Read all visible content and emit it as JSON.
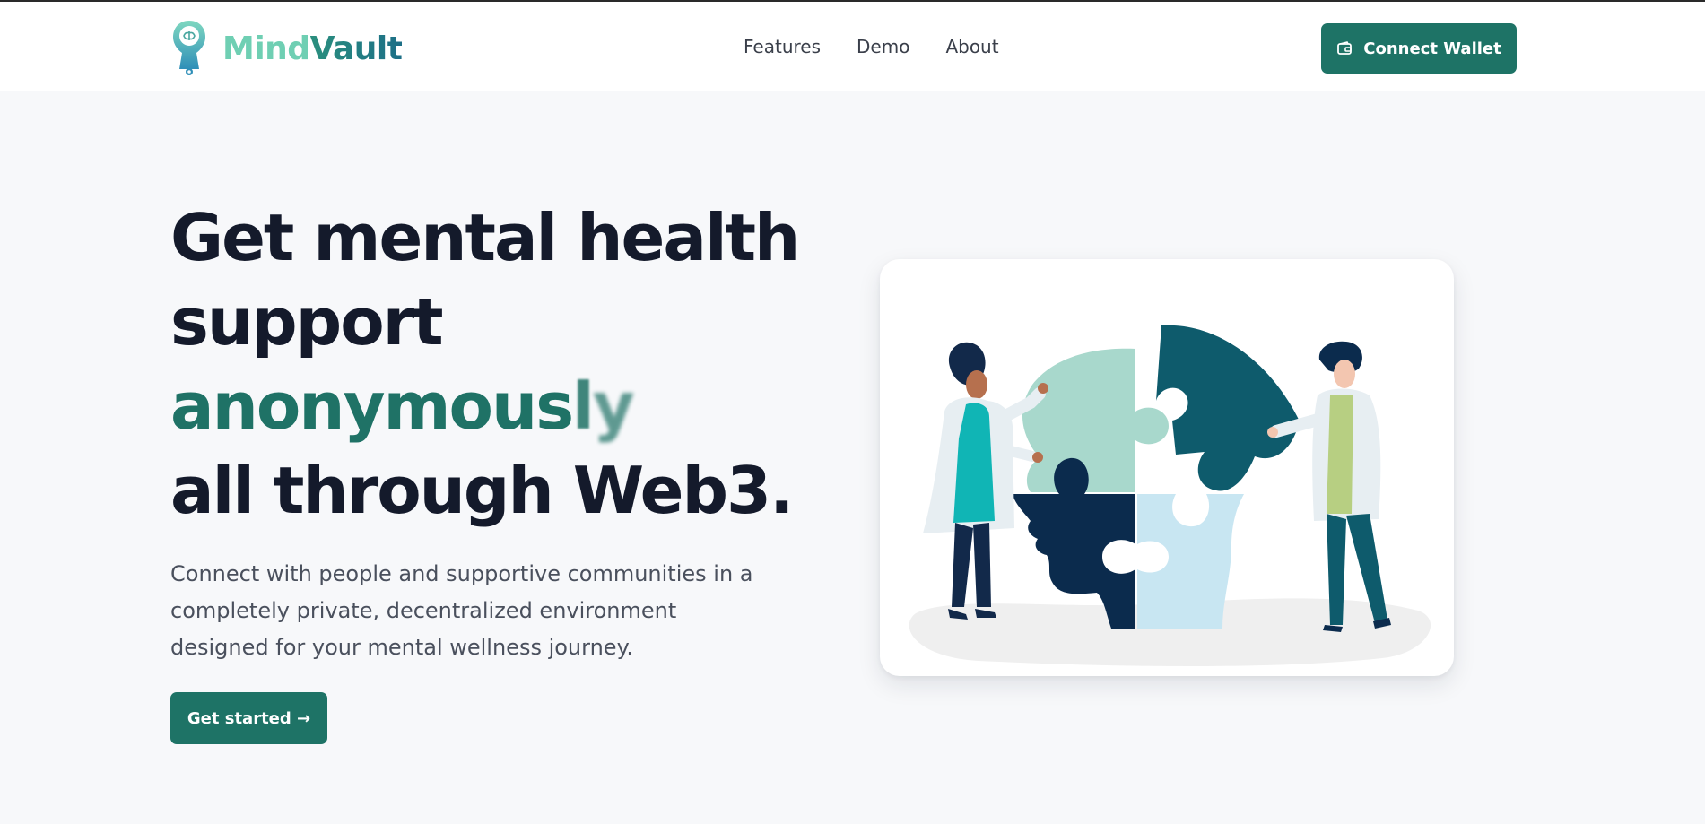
{
  "header": {
    "brand": {
      "part1": "Mind",
      "part2": "Vault",
      "logo_icon": "brain-keyhole-icon"
    },
    "nav": [
      {
        "label": "Features"
      },
      {
        "label": "Demo"
      },
      {
        "label": "About"
      }
    ],
    "connect_wallet": {
      "label": "Connect Wallet",
      "icon": "wallet-icon"
    }
  },
  "hero": {
    "title_line1": "Get mental health",
    "title_line2": "support",
    "title_accent_main": "anonymous",
    "title_accent_soft": "l",
    "title_accent_blur": "y",
    "title_line4": "all through Web3.",
    "description": "Connect with people and supportive communities in a completely private, decentralized environment designed for your mental wellness journey.",
    "cta_label": "Get started →"
  },
  "illustration": {
    "subject": "two people assembling a head-shaped puzzle",
    "colors": [
      "#a8d8cc",
      "#0e5b6c",
      "#0b2b4d",
      "#c8e6f2",
      "#10b5b5"
    ]
  },
  "colors": {
    "primary": "#1e7366",
    "heading": "#141a2b",
    "body_text": "#4a505d",
    "background": "#f7f8fa"
  }
}
